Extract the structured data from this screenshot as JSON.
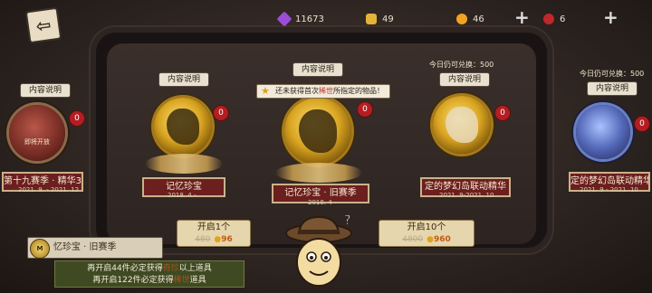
{
  "topbar": {
    "back_icon": "exit-door-icon",
    "resources": [
      {
        "icon": "purple-gem-icon",
        "value": "11673",
        "color": "#9b4dd6"
      },
      {
        "icon": "puzzle-piece-icon",
        "value": "49",
        "color": "#e2b43a"
      },
      {
        "icon": "gold-coin-icon",
        "value": "46",
        "color": "#f2a324"
      },
      {
        "icon": "red-gem-icon",
        "value": "6",
        "color": "#c0262b"
      }
    ],
    "plus": "+"
  },
  "cards": [
    {
      "help": "内容说明",
      "title": "第十九赛季 · 精华3",
      "date": "2021. 9. - 2021. 12",
      "badge": "0",
      "tag": "即将开放"
    },
    {
      "help": "内容说明",
      "title": "记忆珍宝",
      "date": "2018. 4 -",
      "badge": "0"
    },
    {
      "help": "内容说明",
      "title": "记忆珍宝 · 旧赛季",
      "date": "2018. 4 -",
      "badge": "0"
    },
    {
      "help": "内容说明",
      "title": "定的梦幻岛联动精华",
      "date": "2021. 9-2021. 10",
      "badge": "0",
      "exchange": "今日仍可兑换：500"
    },
    {
      "help": "内容说明",
      "title": "定的梦幻岛联动精华",
      "date": "2021. 9 - 2021. 10",
      "badge": "0",
      "exchange": "今日仍可兑换：500"
    }
  ],
  "tooltip": {
    "prefix": "还未获得首次",
    "highlight": "稀世",
    "suffix": "所指定的物品！"
  },
  "buttons": [
    {
      "label": "开启1个",
      "old_cost": "480",
      "new_cost": "96"
    },
    {
      "label": "开启10个",
      "old_cost": "4800",
      "new_cost": "960"
    }
  ],
  "info": {
    "title": "忆珍宝 · 旧赛季",
    "seal": "M",
    "line1_prefix": "再开启44件必定获得",
    "line1_highlight": "奇珍",
    "line1_suffix": "以上道具",
    "line2_prefix": "再开启122件必定获得",
    "line2_highlight": "稀世",
    "line2_suffix": "道具"
  }
}
